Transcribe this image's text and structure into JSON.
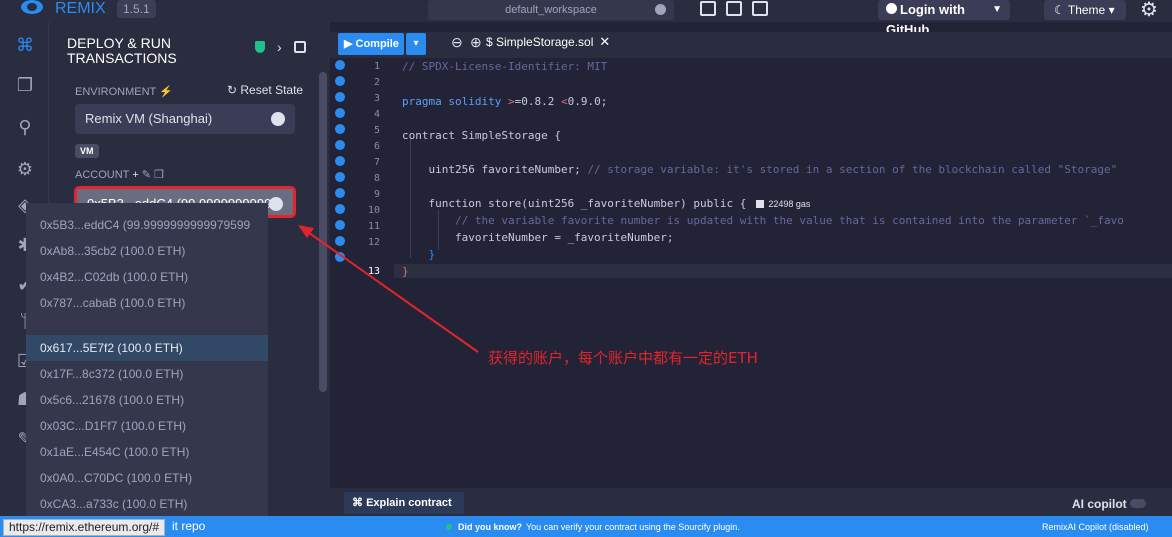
{
  "header": {
    "app_name": "REMIX",
    "version": "1.5.1",
    "workspace": "default_workspace",
    "login_label": "Login with GitHub",
    "theme_label": "Theme"
  },
  "side_panel": {
    "title": "DEPLOY & RUN TRANSACTIONS",
    "environment_label": "ENVIRONMENT",
    "reset_state_label": "Reset State",
    "environment_value": "Remix VM (Shanghai)",
    "vm_badge": "VM",
    "account_label": "ACCOUNT",
    "account_value": "0x5B3...eddC4 (99.9999999999",
    "account_options": [
      "0x5B3...eddC4 (99.9999999999979599",
      "0xAb8...35cb2 (100.0 ETH)",
      "0x4B2...C02db (100.0 ETH)",
      "0x787...cabaB (100.0 ETH)",
      "0x617...5E7f2 (100.0 ETH)",
      "0x17F...8c372 (100.0 ETH)",
      "0x5c6...21678 (100.0 ETH)",
      "0x03C...D1Ff7 (100.0 ETH)",
      "0x1aE...E454C (100.0 ETH)",
      "0x0A0...C70DC (100.0 ETH)",
      "0xCA3...a733c (100.0 ETH)"
    ],
    "active_option_index": 4
  },
  "editor": {
    "compile_label": "Compile",
    "file_tab": "SimpleStorage.sol",
    "line_numbers": [
      "1",
      "2",
      "3",
      "4",
      "5",
      "6",
      "7",
      "8",
      "9",
      "10",
      "11",
      "12",
      "13"
    ],
    "code": {
      "l1": "// SPDX-License-Identifier: MIT",
      "l3_kw": "pragma solidity ",
      "l3_op1": ">",
      "l3_mid": "=0.8.2 ",
      "l3_op2": "<",
      "l3_end": "0.9.0;",
      "l5": "contract SimpleStorage {",
      "l7_a": "    uint256 favoriteNumber; ",
      "l7_b": "// storage variable: it's stored in a section of the blockchain called \"Storage\"",
      "l9": "    function store(uint256 _favoriteNumber) public {",
      "l9_gas": "22498 gas",
      "l10": "        // the variable favorite number is updated with the value that is contained into the parameter `_favo",
      "l11": "        favoriteNumber = _favoriteNumber;",
      "l12": "    }",
      "l13": "}"
    }
  },
  "bottom": {
    "explain_label": "Explain contract",
    "ai_copilot_label": "AI copilot"
  },
  "status_bar": {
    "url_tooltip": "https://remix.ethereum.org/#",
    "repo_text": "it repo",
    "did_you_know": "Did you know?",
    "tip": "You can verify your contract using the Sourcify plugin.",
    "right": "RemixAI Copilot (disabled)"
  },
  "annotation": {
    "text": "获得的账户，每个账户中都有一定的ETH"
  },
  "colors": {
    "accent": "#2a8cf0",
    "annotation": "#e3242b",
    "panel": "#2a2c3f",
    "editor_bg": "#222336"
  }
}
